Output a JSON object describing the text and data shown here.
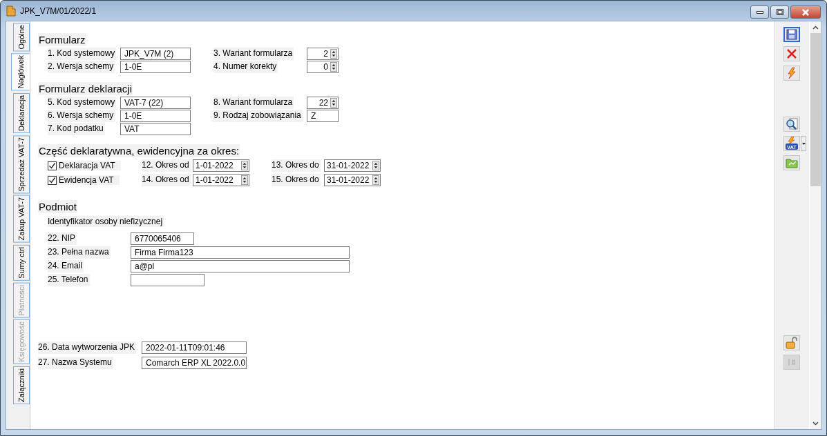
{
  "window": {
    "title": "JPK_V7M/01/2022/1"
  },
  "tabs": [
    {
      "label": "Ogólne",
      "selected": false,
      "disabled": false
    },
    {
      "label": "Nagłówek",
      "selected": true,
      "disabled": false
    },
    {
      "label": "Deklaracja",
      "selected": false,
      "disabled": false
    },
    {
      "label": "Sprzedaż VAT-7",
      "selected": false,
      "disabled": false
    },
    {
      "label": "Zakup VAT-7",
      "selected": false,
      "disabled": false
    },
    {
      "label": "Sumy ctrl",
      "selected": false,
      "disabled": false
    },
    {
      "label": "Płatności",
      "selected": false,
      "disabled": true
    },
    {
      "label": "Księgowość",
      "selected": false,
      "disabled": true
    },
    {
      "label": "Załączniki",
      "selected": false,
      "disabled": false
    }
  ],
  "formularz": {
    "title": "Formularz",
    "fields": [
      {
        "label": "1. Kod systemowy",
        "value": "JPK_V7M (2)",
        "kind": "text"
      },
      {
        "label": "3. Wariant formularza",
        "value": "2",
        "kind": "spin"
      },
      {
        "label": "2. Wersja schemy",
        "value": "1-0E",
        "kind": "text"
      },
      {
        "label": "4. Numer korekty",
        "value": "0",
        "kind": "spin"
      }
    ]
  },
  "formularz_deklaracji": {
    "title": "Formularz deklaracji",
    "fields": [
      {
        "label": "5. Kod systemowy",
        "value": "VAT-7 (22)",
        "kind": "text"
      },
      {
        "label": "8. Wariant formularza",
        "value": "22",
        "kind": "spin"
      },
      {
        "label": "6. Wersja schemy",
        "value": "1-0E",
        "kind": "text"
      },
      {
        "label": "9. Rodzaj zobowiązania",
        "value": "Z",
        "kind": "text"
      },
      {
        "label": "7. Kod podatku",
        "value": "VAT",
        "kind": "text"
      }
    ]
  },
  "okres": {
    "title": "Część deklaratywna, ewidencyjna za okres:",
    "rows": [
      {
        "checkbox": {
          "label": "Deklaracja VAT",
          "checked": true
        },
        "from": {
          "label": "12. Okres od",
          "value": "1-01-2022"
        },
        "to": {
          "label": "13. Okres do",
          "value": "31-01-2022"
        }
      },
      {
        "checkbox": {
          "label": "Ewidencja VAT",
          "checked": true
        },
        "from": {
          "label": "14. Okres od",
          "value": "1-01-2022"
        },
        "to": {
          "label": "15. Okres do",
          "value": "31-01-2022"
        }
      }
    ]
  },
  "podmiot": {
    "title": "Podmiot",
    "subtitle": "Identyfikator osoby niefizycznej",
    "fields": [
      {
        "label": "22. NIP",
        "value": "6770065406"
      },
      {
        "label": "23. Pełna nazwa",
        "value": "Firma Firma123"
      },
      {
        "label": "24. Email",
        "value": "a@pl"
      },
      {
        "label": "25. Telefon"
      }
    ]
  },
  "system": {
    "fields": [
      {
        "label": "26. Data wytworzenia JPK",
        "value": "2022-01-11T09:01:46"
      },
      {
        "label": "27. Nazwa Systemu",
        "value": "Comarch ERP XL 2022.0.0"
      }
    ]
  },
  "toolbar": {
    "vat_badge": "VAT"
  }
}
